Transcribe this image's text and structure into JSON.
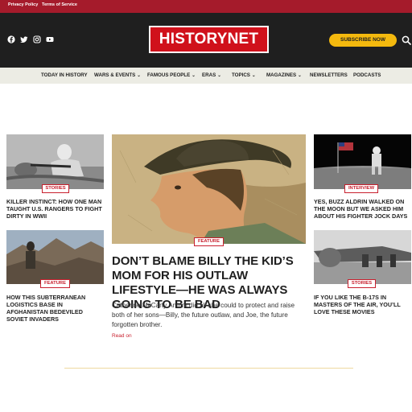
{
  "topbar": {
    "links": [
      "Privacy Policy",
      "Terms of Service"
    ]
  },
  "header": {
    "social_icons": [
      "facebook-icon",
      "twitter-icon",
      "instagram-icon",
      "youtube-icon"
    ],
    "logo_text": "HISTORYNET",
    "subscribe_label": "SUBSCRIBE NOW"
  },
  "nav": {
    "items": [
      {
        "label": "TODAY IN HISTORY",
        "dropdown": false
      },
      {
        "label": "WARS & EVENTS",
        "dropdown": true
      },
      {
        "label": "FAMOUS PEOPLE",
        "dropdown": true
      },
      {
        "label": "ERAS",
        "dropdown": true
      },
      {
        "label": "TOPICS",
        "dropdown": true
      },
      {
        "label": "MAGAZINES",
        "dropdown": true
      },
      {
        "label": "NEWSLETTERS",
        "dropdown": false
      },
      {
        "label": "PODCASTS",
        "dropdown": false
      }
    ]
  },
  "articles": {
    "left_top": {
      "badge": "STORIES",
      "title": "KILLER INSTINCT: HOW ONE MAN TAUGHT U.S. RANGERS TO FIGHT DIRTY IN WWII"
    },
    "left_bottom": {
      "badge": "FEATURE",
      "title": "HOW THIS SUBTERRANEAN LOGISTICS BASE IN AFGHANISTAN BEDEVILED SOVIET INVADERS"
    },
    "main": {
      "badge": "FEATURE",
      "title": "DON’T BLAME BILLY THE KID’S MOM FOR HIS OUTLAW LIFESTYLE—HE WAS ALWAYS GOING TO BE BAD",
      "excerpt": "Catherine McCarty Antrim did all she could to protect and raise both of her sons—Billy, the future outlaw, and Joe, the future forgotten brother.",
      "read_on": "Read on"
    },
    "right_top": {
      "badge": "INTERVIEW",
      "title": "YES, BUZZ ALDRIN WALKED ON THE MOON BUT WE ASKED HIM ABOUT HIS FIGHTER JOCK DAYS"
    },
    "right_bottom": {
      "badge": "STORIES",
      "title": "IF YOU LIKE THE B-17S IN MASTERS OF THE AIR, YOU’LL LOVE THESE MOVIES"
    }
  },
  "colors": {
    "topbar": "#a51b2b",
    "header": "#1f1f1f",
    "logo": "#d0111b",
    "subscribe": "#f4b90e",
    "nav": "#ecece4",
    "accent": "#c8202e"
  }
}
